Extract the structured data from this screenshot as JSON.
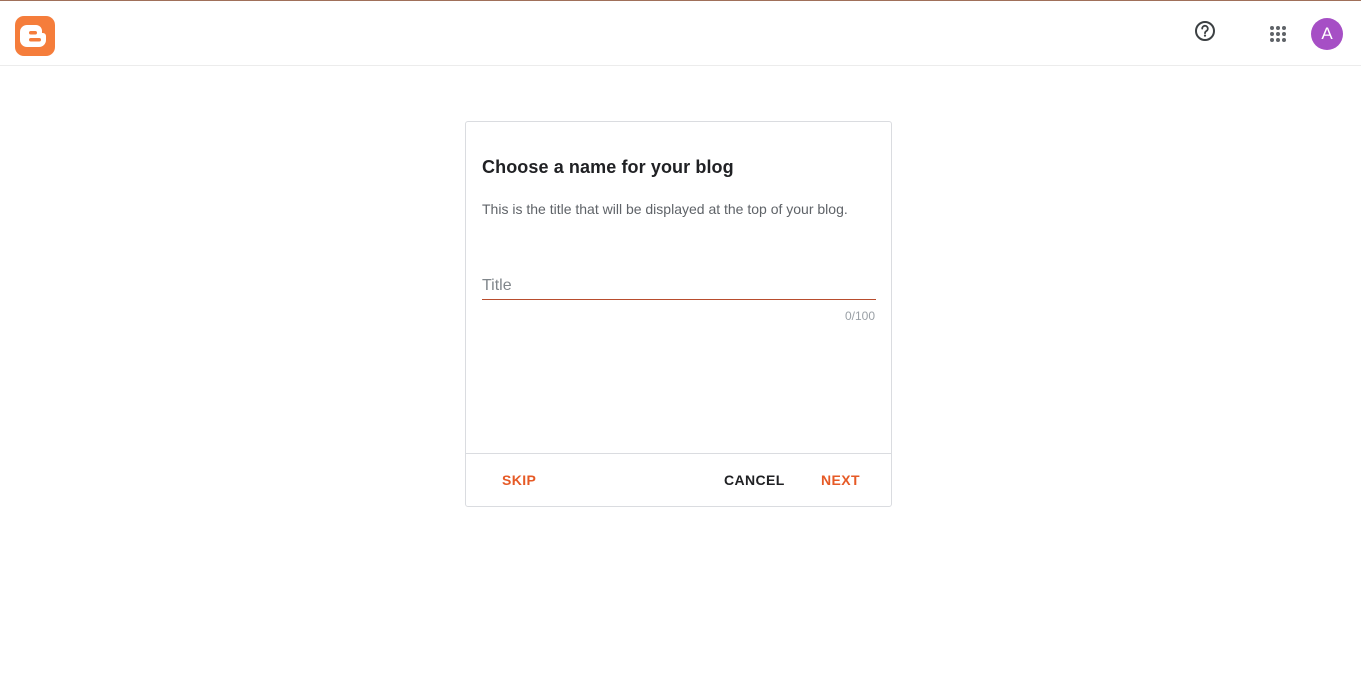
{
  "header": {
    "logo_icon": "blogger-logo-icon",
    "help_icon": "help-circle-icon",
    "apps_icon": "apps-grid-icon",
    "avatar_initial": "A",
    "avatar_color": "#a64fc5",
    "brand_color": "#f57d3b"
  },
  "dialog": {
    "title": "Choose a name for your blog",
    "description": "This is the title that will be displayed at the top of your blog.",
    "title_input": {
      "value": "",
      "placeholder": "Title"
    },
    "char_counter": "0/100",
    "actions": {
      "skip_label": "SKIP",
      "cancel_label": "CANCEL",
      "next_label": "NEXT"
    },
    "accent_color": "#e65a26"
  }
}
